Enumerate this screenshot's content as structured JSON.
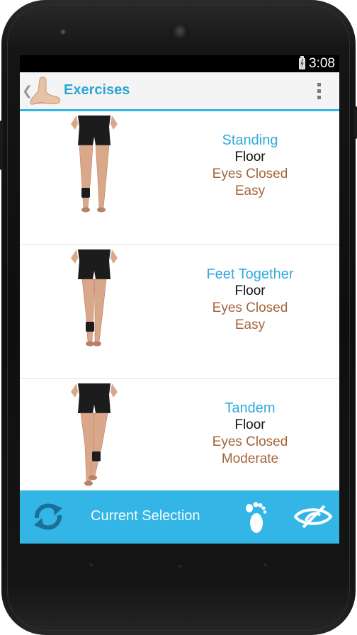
{
  "status_bar": {
    "time": "3:08",
    "battery_icon": "battery-charging-icon"
  },
  "action_bar": {
    "title": "Exercises",
    "icons": [
      "up-caret-icon",
      "foot-app-icon",
      "overflow-menu-icon"
    ]
  },
  "exercises": [
    {
      "name": "Standing",
      "surface": "Floor",
      "eyes": "Eyes Closed",
      "level": "Easy",
      "stance": "apart"
    },
    {
      "name": "Feet Together",
      "surface": "Floor",
      "eyes": "Eyes Closed",
      "level": "Easy",
      "stance": "together"
    },
    {
      "name": "Tandem",
      "surface": "Floor",
      "eyes": "Eyes Closed",
      "level": "Moderate",
      "stance": "tandem"
    }
  ],
  "bottom_bar": {
    "label": "Current Selection",
    "icons": [
      "refresh-icon",
      "footprint-icon",
      "eye-closed-icon"
    ]
  },
  "colors": {
    "accent": "#33b5e5",
    "title": "#2ea5d6",
    "detail": "#a4643b"
  }
}
